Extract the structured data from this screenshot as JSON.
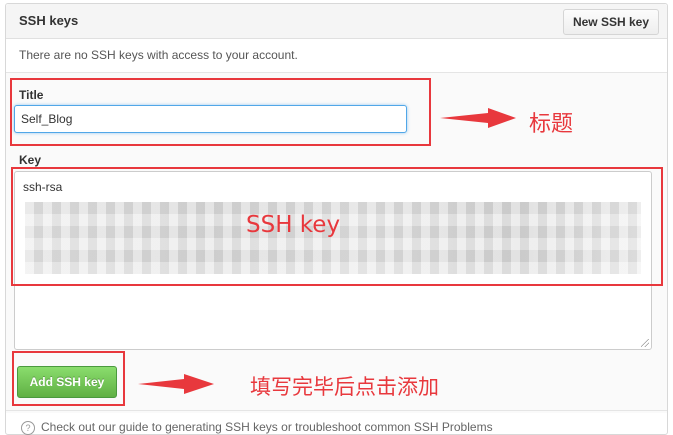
{
  "panel": {
    "title": "SSH keys",
    "new_key_label": "New SSH key",
    "empty_message": "There are no SSH keys with access to your account."
  },
  "form": {
    "title_label": "Title",
    "title_value": "Self_Blog",
    "key_label": "Key",
    "key_value_visible": "ssh-rsa",
    "submit_label": "Add SSH key"
  },
  "footer": {
    "help_text": "Check out our guide to generating SSH keys or troubleshoot common SSH Problems"
  },
  "annotations": {
    "title_note": "标题",
    "key_note": "SSH key",
    "submit_note": "填写完毕后点击添加",
    "color": "#e8383d"
  }
}
